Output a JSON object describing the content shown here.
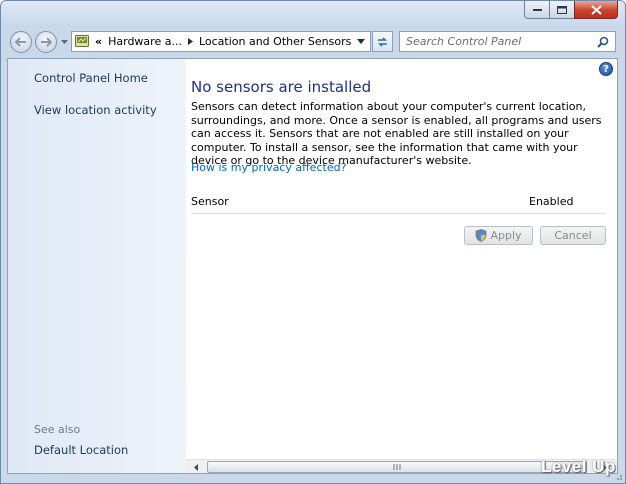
{
  "window": {
    "controls": {
      "minimize_icon": "minimize-icon",
      "maximize_icon": "maximize-icon",
      "close_icon": "close-icon"
    }
  },
  "toolbar": {
    "breadcrumb": {
      "icon": "control-panel-icon",
      "overflow": "«",
      "items": [
        "Hardware a...",
        "Location and Other Sensors"
      ],
      "separator_icon": "chevron-right-icon"
    },
    "refresh_icon": "refresh-icon",
    "search": {
      "placeholder": "Search Control Panel",
      "icon": "search-icon"
    }
  },
  "sidebar": {
    "links": [
      "Control Panel Home",
      "View location activity"
    ],
    "see_also_label": "See also",
    "see_also_links": [
      "Default Location"
    ]
  },
  "main": {
    "title": "No sensors are installed",
    "description": "Sensors can detect information about your computer's current location, surroundings, and more. Once a sensor is enabled, all programs and users can access it. Sensors that are not enabled are still installed on your computer. To install a sensor, see the information that came with your device or go to the device manufacturer's website.",
    "privacy_link": "How is my privacy affected?",
    "columns": [
      "Sensor",
      "Enabled"
    ],
    "buttons": {
      "apply": "Apply",
      "cancel": "Cancel"
    }
  },
  "watermark": "Level Up",
  "colors": {
    "title": "#1e3287",
    "link": "#0066cc",
    "sidebar_link": "#1e395b",
    "frame": "#c9d9ea"
  }
}
